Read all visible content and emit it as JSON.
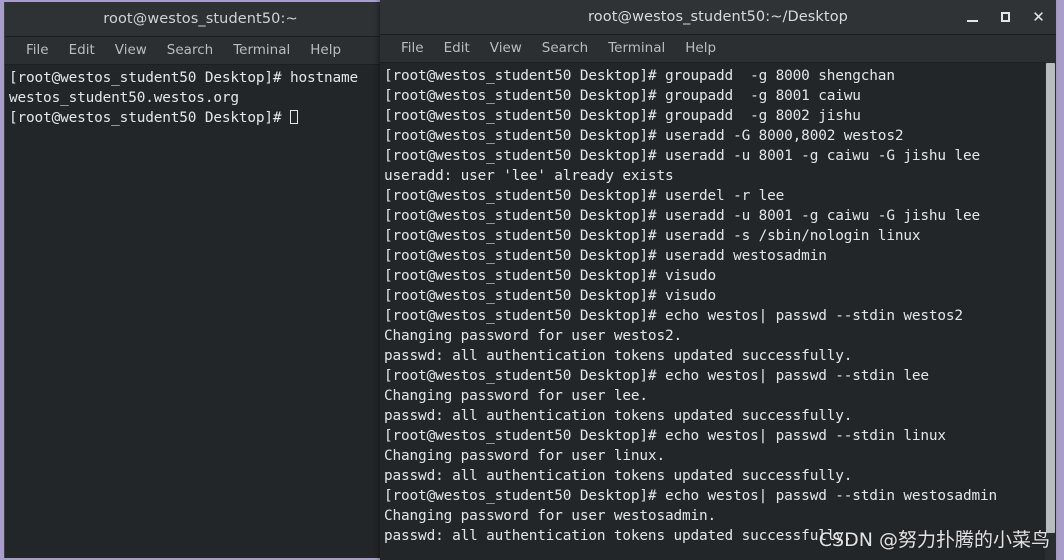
{
  "desktop": {
    "background_color": "#a99ec9"
  },
  "colors": {
    "titlebar": "#2f3336",
    "menubar": "#2b2f31",
    "terminal_background": "#232629",
    "terminal_text": "#e4e7e9",
    "menu_text": "#b9bdc0",
    "scrollbar_thumb": "#b9bcbe"
  },
  "windows": {
    "left": {
      "title": "root@westos_student50:~",
      "menu": [
        {
          "label": "File"
        },
        {
          "label": "Edit"
        },
        {
          "label": "View"
        },
        {
          "label": "Search"
        },
        {
          "label": "Terminal"
        },
        {
          "label": "Help"
        }
      ],
      "lines": [
        "[root@westos_student50 Desktop]# hostname",
        "westos_student50.westos.org",
        "[root@westos_student50 Desktop]# "
      ],
      "cursor_on_last_line": true
    },
    "right": {
      "title": "root@westos_student50:~/Desktop",
      "controls": {
        "minimize": "minimize-icon",
        "maximize": "maximize-icon",
        "close": "close-icon"
      },
      "menu": [
        {
          "label": "File"
        },
        {
          "label": "Edit"
        },
        {
          "label": "View"
        },
        {
          "label": "Search"
        },
        {
          "label": "Terminal"
        },
        {
          "label": "Help"
        }
      ],
      "lines": [
        "[root@westos_student50 Desktop]# groupadd  -g 8000 shengchan",
        "[root@westos_student50 Desktop]# groupadd  -g 8001 caiwu",
        "[root@westos_student50 Desktop]# groupadd  -g 8002 jishu",
        "[root@westos_student50 Desktop]# useradd -G 8000,8002 westos2",
        "[root@westos_student50 Desktop]# useradd -u 8001 -g caiwu -G jishu lee",
        "useradd: user 'lee' already exists",
        "[root@westos_student50 Desktop]# userdel -r lee",
        "[root@westos_student50 Desktop]# useradd -u 8001 -g caiwu -G jishu lee",
        "[root@westos_student50 Desktop]# useradd -s /sbin/nologin linux",
        "[root@westos_student50 Desktop]# useradd westosadmin",
        "[root@westos_student50 Desktop]# visudo",
        "[root@westos_student50 Desktop]# visudo",
        "[root@westos_student50 Desktop]# echo westos| passwd --stdin westos2",
        "Changing password for user westos2.",
        "passwd: all authentication tokens updated successfully.",
        "[root@westos_student50 Desktop]# echo westos| passwd --stdin lee",
        "Changing password for user lee.",
        "passwd: all authentication tokens updated successfully.",
        "[root@westos_student50 Desktop]# echo westos| passwd --stdin linux",
        "Changing password for user linux.",
        "passwd: all authentication tokens updated successfully.",
        "[root@westos_student50 Desktop]# echo westos| passwd --stdin westosadmin",
        "Changing password for user westosadmin.",
        "passwd: all authentication tokens updated successfully."
      ]
    }
  },
  "watermark": {
    "text": "CSDN @努力扑腾的小菜鸟"
  }
}
